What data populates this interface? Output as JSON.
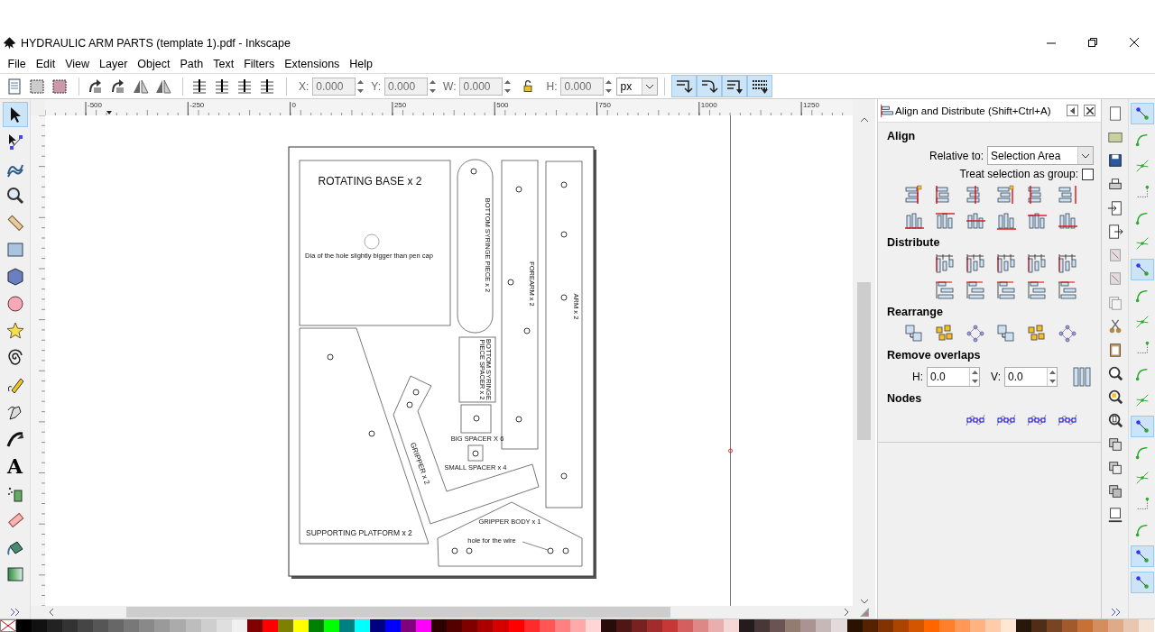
{
  "window": {
    "title": "HYDRAULIC ARM PARTS (template 1).pdf - Inkscape"
  },
  "menu": [
    "File",
    "Edit",
    "View",
    "Layer",
    "Object",
    "Path",
    "Text",
    "Filters",
    "Extensions",
    "Help"
  ],
  "toolbar": {
    "fields": [
      {
        "label": "X:",
        "value": "0.000",
        "disabled": true
      },
      {
        "label": "Y:",
        "value": "0.000",
        "disabled": true
      },
      {
        "label": "W:",
        "value": "0.000",
        "disabled": true
      },
      {
        "label": "H:",
        "value": "0.000",
        "disabled": true
      }
    ],
    "unit": "px",
    "toggles": [
      {
        "on": true
      },
      {
        "on": true
      },
      {
        "on": true
      },
      {
        "on": true
      }
    ]
  },
  "ruler": {
    "labels": [
      "-500",
      "-250",
      "0",
      "250",
      "500",
      "750",
      "1000",
      "1250"
    ]
  },
  "tools": [
    {
      "kind": "selector",
      "selected": true
    },
    {
      "kind": "node",
      "selected": false
    },
    {
      "kind": "tweak",
      "selected": false
    },
    {
      "kind": "zoom",
      "selected": false
    },
    {
      "kind": "measure",
      "selected": false
    },
    {
      "kind": "rect",
      "selected": false
    },
    {
      "kind": "box3d",
      "selected": false
    },
    {
      "kind": "ellipse",
      "selected": false
    },
    {
      "kind": "star",
      "selected": false
    },
    {
      "kind": "spiral",
      "selected": false
    },
    {
      "kind": "pencil",
      "selected": false
    },
    {
      "kind": "pen",
      "selected": false
    },
    {
      "kind": "calligraphy",
      "selected": false
    },
    {
      "kind": "text",
      "glyph": "A",
      "selected": false
    },
    {
      "kind": "spray",
      "selected": false
    },
    {
      "kind": "eraser",
      "selected": false
    },
    {
      "kind": "bucket",
      "selected": false
    },
    {
      "kind": "gradient",
      "selected": false
    }
  ],
  "document": {
    "rotating_base": "ROTATING BASE x 2",
    "hole_note": "Dia of the hole slightly bigger than pen cap",
    "bottom_syringe": "BOTTOM SYRINGE PIECE x 2",
    "forearm": "FOREARM x 2",
    "arm": "ARM x 2",
    "spacer_piece": [
      "BOTTOM SYRINGE",
      "PIECE  SPACER x 2"
    ],
    "big_spacer": "BIG SPACER X 6",
    "small_spacer": "SMALL SPACER x 4",
    "gripper": "GRIPPER x 2",
    "supporting_platform": "SUPPORTING PLATFORM x 2",
    "gripper_body": "GRIPPER BODY x 1",
    "wire_note": "hole for the wire"
  },
  "dock": {
    "title": "Align and Distribute (Shift+Ctrl+A)",
    "align": {
      "heading": "Align",
      "relative_label": "Relative to:",
      "relative_value": "Selection Area",
      "group_label": "Treat selection as group:",
      "group_checked": false
    },
    "distribute": {
      "heading": "Distribute"
    },
    "rearrange": {
      "heading": "Rearrange"
    },
    "overlaps": {
      "heading": "Remove overlaps",
      "h_label": "H:",
      "h_value": "0.0",
      "v_label": "V:",
      "v_value": "0.0"
    },
    "nodes": {
      "heading": "Nodes"
    }
  },
  "snap_bar": [
    {
      "selected": true
    },
    {
      "selected": false
    },
    {
      "selected": false
    },
    {
      "selected": false
    },
    {
      "selected": false
    },
    {
      "selected": false
    },
    {
      "selected": true
    },
    {
      "selected": false
    },
    {
      "selected": false
    },
    {
      "selected": false
    },
    {
      "selected": false
    },
    {
      "selected": false
    },
    {
      "selected": true
    },
    {
      "selected": false
    },
    {
      "selected": false
    },
    {
      "selected": false
    },
    {
      "selected": false
    },
    {
      "selected": true
    },
    {
      "selected": true
    }
  ]
}
